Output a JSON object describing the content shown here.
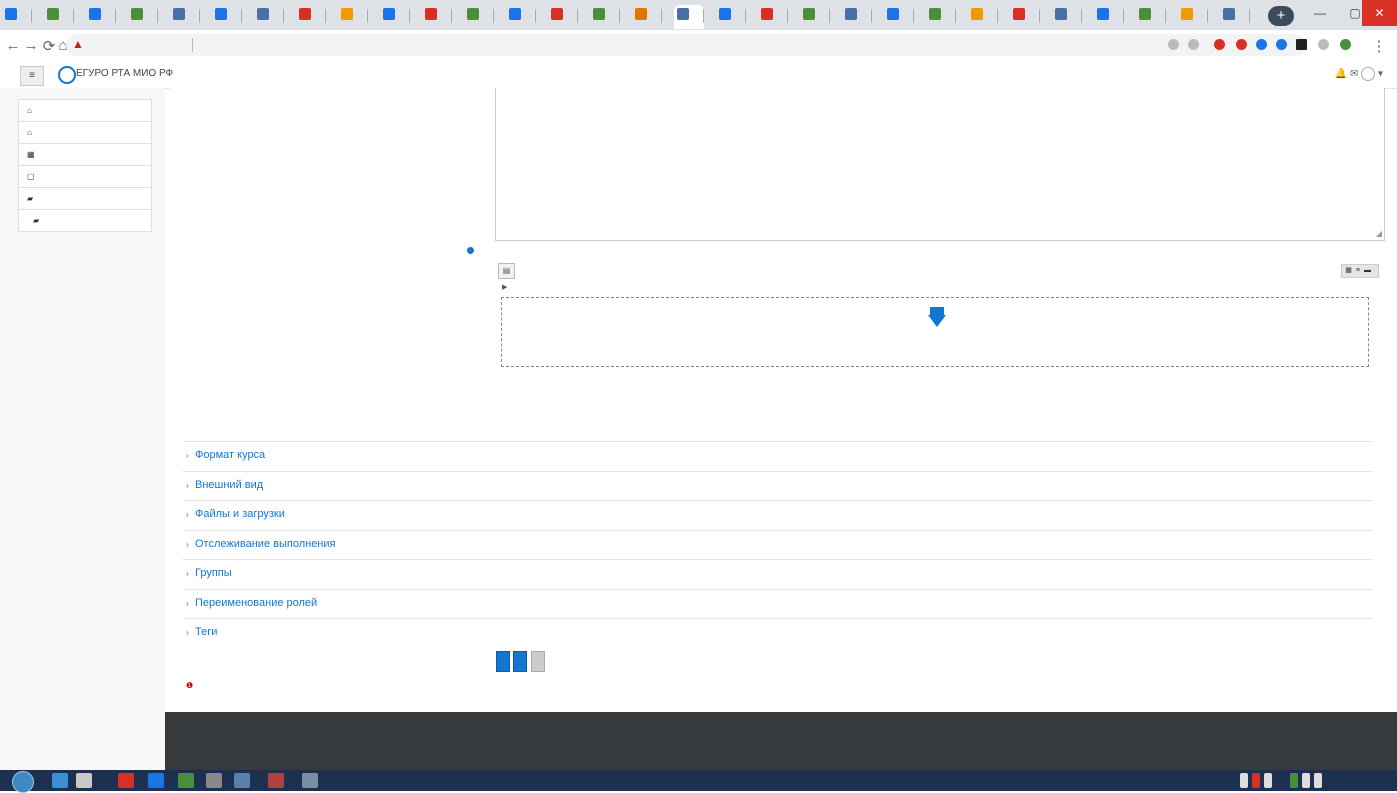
{
  "colors": {
    "accent": "#1177d1",
    "footer_bg": "#373a3c",
    "required": "#cc0000",
    "taskbar": "#1e3050",
    "secondary_button": "#cccccc"
  },
  "browser": {
    "tab_favicon_colors": [
      "#1a73e8",
      "#4a8f3c",
      "#1a73e8",
      "#4a8f3c",
      "#4a6fa5",
      "#1a73e8",
      "#4a6fa5",
      "#d93025",
      "#f29900",
      "#1a73e8",
      "#d93025",
      "#4a8f3c",
      "#1a73e8",
      "#d93025",
      "#4a8f3c",
      "#e37400",
      "#4a6fa5",
      "#1a73e8",
      "#d93025",
      "#4a8f3c",
      "#4a6fa5",
      "#1a73e8",
      "#4a8f3c",
      "#f29900",
      "#d93025",
      "#4a6fa5",
      "#1a73e8",
      "#4a8f3c",
      "#f29900",
      "#4a6fa5"
    ],
    "new_tab_label": "+"
  },
  "moodle_nav": {
    "site_name": "ЕГУРО РТА МИО РФ"
  },
  "drawer": {
    "items": [
      {
        "icon": "dashboard-icon",
        "glyph": "⌂"
      },
      {
        "icon": "home-icon",
        "glyph": "⌂"
      },
      {
        "icon": "calendar-icon",
        "glyph": "▦"
      },
      {
        "icon": "files-icon",
        "glyph": "▢"
      },
      {
        "icon": "courses-icon",
        "glyph": "▰"
      },
      {
        "icon": "course-icon",
        "glyph": "▰"
      }
    ]
  },
  "form": {
    "filepicker": {
      "add_glyph": "▤",
      "views_glyphs": "▦≡▬",
      "path_glyph": "▶"
    },
    "sections": [
      {
        "title": "Формат курса"
      },
      {
        "title": "Внешний вид"
      },
      {
        "title": "Файлы и загрузки"
      },
      {
        "title": "Отслеживание выполнения"
      },
      {
        "title": "Группы"
      },
      {
        "title": "Переименование ролей"
      },
      {
        "title": "Теги"
      }
    ]
  }
}
